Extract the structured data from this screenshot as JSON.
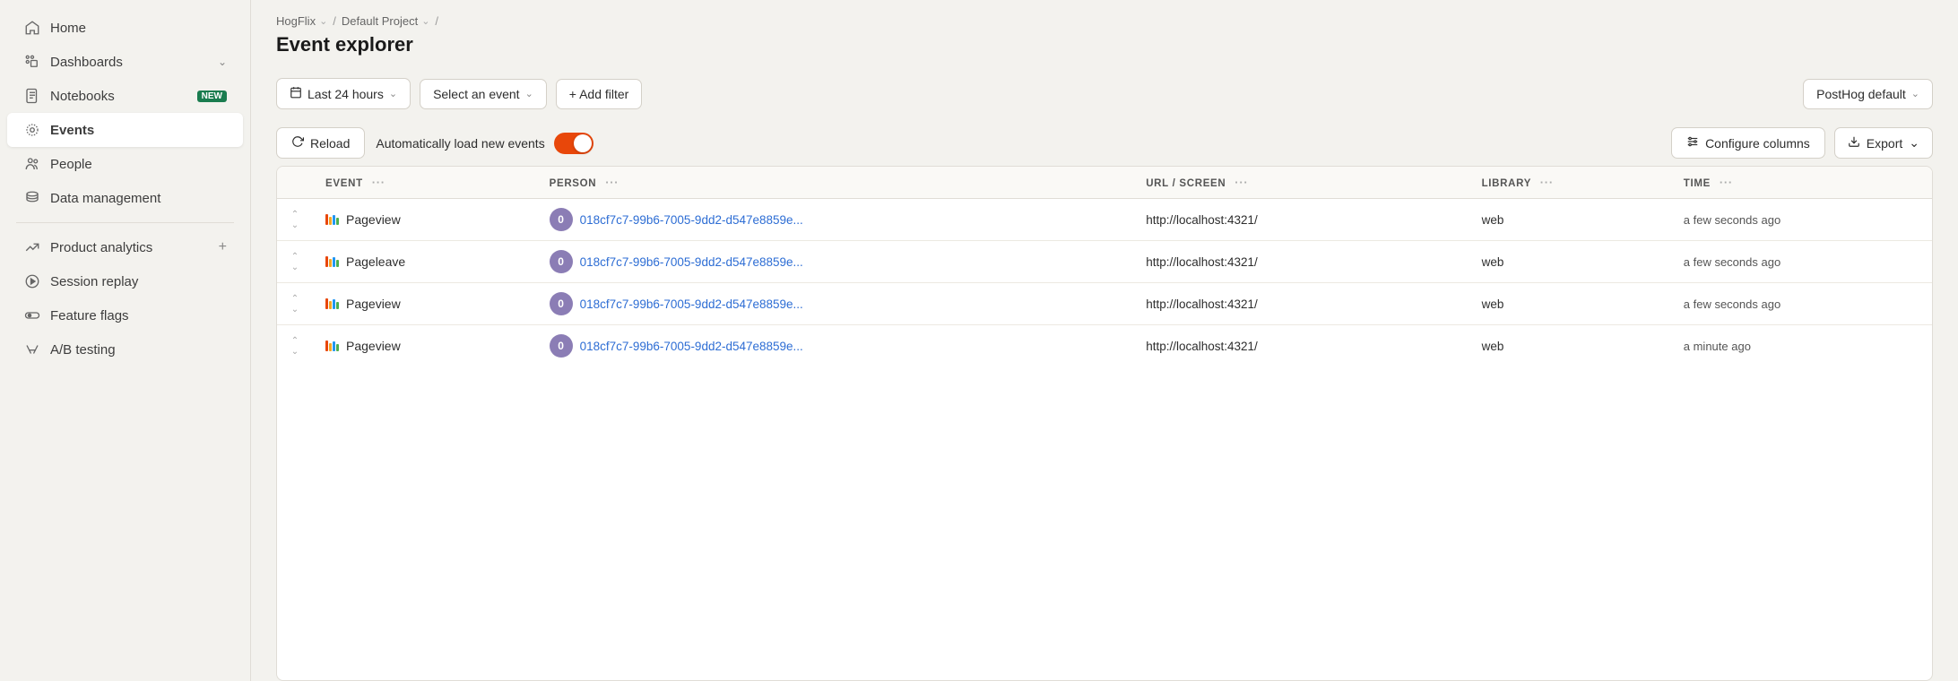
{
  "sidebar": {
    "items": [
      {
        "id": "home",
        "label": "Home",
        "icon": "home",
        "active": false
      },
      {
        "id": "dashboards",
        "label": "Dashboards",
        "icon": "dashboards",
        "active": false,
        "hasChevron": true
      },
      {
        "id": "notebooks",
        "label": "Notebooks",
        "icon": "notebooks",
        "active": false,
        "badge": "NEW"
      },
      {
        "id": "events",
        "label": "Events",
        "icon": "events",
        "active": true
      },
      {
        "id": "people",
        "label": "People",
        "icon": "people",
        "active": false
      },
      {
        "id": "data-management",
        "label": "Data management",
        "icon": "data-management",
        "active": false
      },
      {
        "id": "product-analytics",
        "label": "Product analytics",
        "icon": "product-analytics",
        "active": false,
        "hasPlus": true
      },
      {
        "id": "session-replay",
        "label": "Session replay",
        "icon": "session-replay",
        "active": false
      },
      {
        "id": "feature-flags",
        "label": "Feature flags",
        "icon": "feature-flags",
        "active": false
      },
      {
        "id": "ab-testing",
        "label": "A/B testing",
        "icon": "ab-testing",
        "active": false
      }
    ]
  },
  "breadcrumb": {
    "parts": [
      {
        "label": "HogFlix",
        "hasChevron": true
      },
      {
        "label": "Default Project",
        "hasChevron": true
      }
    ],
    "separator": "/"
  },
  "page": {
    "title": "Event explorer"
  },
  "toolbar": {
    "time_filter_label": "Last 24 hours",
    "event_filter_label": "Select an event",
    "add_filter_label": "+ Add filter",
    "posthog_default_label": "PostHog default"
  },
  "action_bar": {
    "reload_label": "Reload",
    "auto_load_label": "Automatically load new events",
    "configure_columns_label": "Configure columns",
    "export_label": "Export"
  },
  "table": {
    "columns": [
      {
        "id": "event",
        "label": "EVENT"
      },
      {
        "id": "person",
        "label": "PERSON"
      },
      {
        "id": "url",
        "label": "URL / SCREEN"
      },
      {
        "id": "library",
        "label": "LIBRARY"
      },
      {
        "id": "time",
        "label": "TIME"
      }
    ],
    "rows": [
      {
        "event": "Pageview",
        "person_id": "018cf7c7-99b6-7005-9dd2-d547e8859e...",
        "url": "http://localhost:4321/",
        "library": "web",
        "time": "a few seconds ago"
      },
      {
        "event": "Pageleave",
        "person_id": "018cf7c7-99b6-7005-9dd2-d547e8859e...",
        "url": "http://localhost:4321/",
        "library": "web",
        "time": "a few seconds ago"
      },
      {
        "event": "Pageview",
        "person_id": "018cf7c7-99b6-7005-9dd2-d547e8859e...",
        "url": "http://localhost:4321/",
        "library": "web",
        "time": "a few seconds ago"
      },
      {
        "event": "Pageview",
        "person_id": "018cf7c7-99b6-7005-9dd2-d547e8859e...",
        "url": "http://localhost:4321/",
        "library": "web",
        "time": "a minute ago"
      }
    ]
  }
}
